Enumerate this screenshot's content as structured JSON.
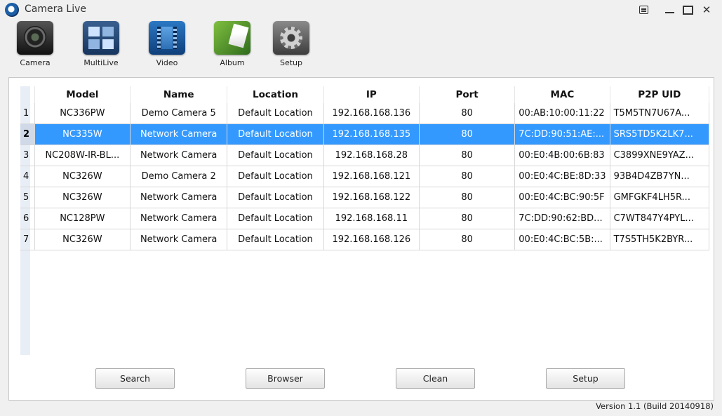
{
  "window": {
    "title": "Camera Live",
    "controls": [
      "menu-icon",
      "minimize-icon",
      "maximize-icon",
      "close-icon"
    ]
  },
  "toolbar": {
    "items": [
      {
        "label": "Camera",
        "icon": "camera-icon"
      },
      {
        "label": "MultiLive",
        "icon": "multilive-icon"
      },
      {
        "label": "Video",
        "icon": "video-icon"
      },
      {
        "label": "Album",
        "icon": "album-icon"
      },
      {
        "label": "Setup",
        "icon": "setup-icon"
      }
    ]
  },
  "table": {
    "columns": [
      "",
      "Model",
      "Name",
      "Location",
      "IP",
      "Port",
      "MAC",
      "P2P UID"
    ],
    "selected_row": 2,
    "selection_color": "#3399ff",
    "rows": [
      {
        "n": "1",
        "model": "NC336PW",
        "name": "Demo Camera 5",
        "location": "Default Location",
        "ip": "192.168.168.136",
        "port": "80",
        "mac": "00:AB:10:00:11:22",
        "uid": "T5M5TN7U67A..."
      },
      {
        "n": "2",
        "model": "NC335W",
        "name": "Network Camera",
        "location": "Default Location",
        "ip": "192.168.168.135",
        "port": "80",
        "mac": "7C:DD:90:51:AE:...",
        "uid": "SRS5TD5K2LK7..."
      },
      {
        "n": "3",
        "model": "NC208W-IR-BL...",
        "name": "Network Camera",
        "location": "Default Location",
        "ip": "192.168.168.28",
        "port": "80",
        "mac": "00:E0:4B:00:6B:83",
        "uid": "C3899XNE9YAZ..."
      },
      {
        "n": "4",
        "model": "NC326W",
        "name": "Demo Camera 2",
        "location": "Default Location",
        "ip": "192.168.168.121",
        "port": "80",
        "mac": "00:E0:4C:BE:8D:33",
        "uid": "93B4D4ZB7YN..."
      },
      {
        "n": "5",
        "model": "NC326W",
        "name": "Network Camera",
        "location": "Default Location",
        "ip": "192.168.168.122",
        "port": "80",
        "mac": "00:E0:4C:BC:90:5F",
        "uid": "GMFGKF4LH5R..."
      },
      {
        "n": "6",
        "model": "NC128PW",
        "name": "Network Camera",
        "location": "Default Location",
        "ip": "192.168.168.11",
        "port": "80",
        "mac": "7C:DD:90:62:BD...",
        "uid": "C7WT847Y4PYL..."
      },
      {
        "n": "7",
        "model": "NC326W",
        "name": "Network Camera",
        "location": "Default Location",
        "ip": "192.168.168.126",
        "port": "80",
        "mac": "00:E0:4C:BC:5B:...",
        "uid": "T7S5TH5K2BYR..."
      }
    ]
  },
  "buttons": {
    "search": "Search",
    "browser": "Browser",
    "clean": "Clean",
    "setup": "Setup"
  },
  "footer": {
    "version": "Version 1.1 (Build 20140918)"
  }
}
